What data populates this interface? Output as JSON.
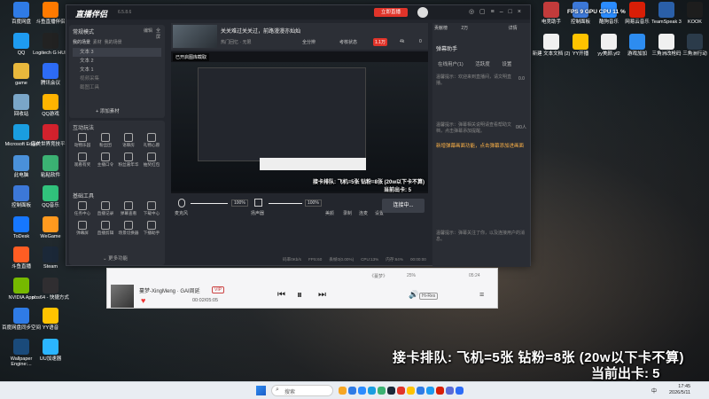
{
  "desktop_left_icons": [
    {
      "label": "百度网盘",
      "icon": "baidu-netdisk-icon",
      "color": "#2f7be5"
    },
    {
      "label": "斗鱼直播伴侣",
      "icon": "douyu-icon",
      "color": "#ff7a00"
    },
    {
      "label": "QQ",
      "icon": "qq-icon",
      "color": "#1e9bf0"
    },
    {
      "label": "Logitech G HUB",
      "icon": "logitech-icon",
      "color": "#222"
    },
    {
      "label": "game",
      "icon": "folder-icon",
      "color": "#e8b83c"
    },
    {
      "label": "腾讯会议",
      "icon": "tencent-meeting-icon",
      "color": "#2d6cf6"
    },
    {
      "label": "回收站",
      "icon": "recycle-bin-icon",
      "color": "#7aa6c8"
    },
    {
      "label": "QQ游戏",
      "icon": "qqgame-icon",
      "color": "#ffb400"
    },
    {
      "label": "Microsoft Edge",
      "icon": "edge-icon",
      "color": "#1a9de0"
    },
    {
      "label": "完美世界竞技平台",
      "icon": "perfect-world-icon",
      "color": "#d2222d"
    },
    {
      "label": "此电脑",
      "icon": "this-pc-icon",
      "color": "#4a90d9"
    },
    {
      "label": "粘粘软件",
      "icon": "app-icon",
      "color": "#3bb273"
    },
    {
      "label": "控制面板",
      "icon": "control-panel-icon",
      "color": "#3c78d8"
    },
    {
      "label": "QQ音乐",
      "icon": "qqmusic-icon",
      "color": "#31c27c"
    },
    {
      "label": "ToDesk",
      "icon": "todesk-icon",
      "color": "#1677ff"
    },
    {
      "label": "WeGame",
      "icon": "wegame-icon",
      "color": "#ff9a1f"
    },
    {
      "label": "斗鱼直播",
      "icon": "douyu-live-icon",
      "color": "#ff5d23"
    },
    {
      "label": "Steam",
      "icon": "steam-icon",
      "color": "#1b2838"
    },
    {
      "label": "NVIDIA App",
      "icon": "nvidia-icon",
      "color": "#76b900"
    },
    {
      "label": "obs64 - 快捷方式",
      "icon": "obs-icon",
      "color": "#302e31"
    },
    {
      "label": "百度网盘同步空间",
      "icon": "baidu-sync-icon",
      "color": "#2f7be5"
    },
    {
      "label": "YY语音",
      "icon": "yy-icon",
      "color": "#ffc300"
    },
    {
      "label": "Wallpaper Engine:...",
      "icon": "wallpaper-engine-icon",
      "color": "#1a4a7a"
    },
    {
      "label": "UU加速器",
      "icon": "uu-icon",
      "color": "#2bb5ff"
    }
  ],
  "desktop_top_icons": [
    {
      "label": "电竞助手",
      "icon": "esports-icon",
      "color": "#c23b3b"
    },
    {
      "label": "控制面板",
      "icon": "control-panel-icon",
      "color": "#3c78d8"
    },
    {
      "label": "酷狗音乐",
      "icon": "kugou-icon",
      "color": "#2b8cff"
    },
    {
      "label": "网易云音乐",
      "icon": "netease-music-icon",
      "color": "#d81e06"
    },
    {
      "label": "TeamSpeak 3",
      "icon": "teamspeak-icon",
      "color": "#2a5fa8"
    },
    {
      "label": "KOOK",
      "icon": "kook-icon",
      "color": "#1d1d1d"
    }
  ],
  "desktop_mid_icons": [
    {
      "label": "新建 文本文档 (2)",
      "icon": "text-file-icon",
      "color": "#f0f0f0"
    },
    {
      "label": "YY开播",
      "icon": "yy-live-icon",
      "color": "#ffc300"
    },
    {
      "label": "yy美颜.yf2",
      "icon": "file-icon",
      "color": "#f0f0f0"
    },
    {
      "label": "游戏加加",
      "icon": "game-plus-icon",
      "color": "#2d8cf0"
    },
    {
      "label": "三角洲改枪码",
      "icon": "doc-icon",
      "color": "#f0f0f0"
    },
    {
      "label": "三角洲行动",
      "icon": "delta-force-icon",
      "color": "#2b3b4a"
    }
  ],
  "perf_overlay": "FPS  9 GPU  CPU  11 %",
  "app": {
    "logo": "直播伴侣",
    "version": "6.5.8.6",
    "stream_title": "关关难过关关过，前路漫漫亦灿灿",
    "start_stream_label": "立即直播",
    "live_assistant_label": "开播提醒",
    "share_label": "分享",
    "username_tag": "热门回忆 · 无限",
    "volume_tag": "全分辨",
    "exam_label": "考核状态",
    "score_badge": "1.1万",
    "likes": "4k",
    "fans": "0",
    "header_labels": [
      "常规模式",
      "编辑",
      "全屏"
    ],
    "scene_tabs": [
      "我的场景",
      "素材",
      "我的场景"
    ],
    "scene_items": [
      "文本 3",
      "文本 2",
      "文本 1",
      "视频采集",
      "截图工具"
    ],
    "add_material_label": "添加素材",
    "interactive_title": "互动玩法",
    "interactive_tools": [
      "动物乐园",
      "粉丝团",
      "语聊房",
      "礼物心愿",
      "观看有奖",
      "主播口令",
      "粉丝嘉年华",
      "抽奖红包"
    ],
    "basic_tools_title": "基础工具",
    "basic_tools": [
      "任务中心",
      "直播记录",
      "弹幕查看",
      "下载中心",
      "弹幕屏",
      "直播剪辑",
      "场景切换器",
      "下播助手"
    ],
    "more_label": "更多功能",
    "preview_badge": "已开启图库截取",
    "audio": {
      "mic_label": "麦克风",
      "mic_value": "100%",
      "speaker_label": "扬声器",
      "speaker_value": "100%",
      "beauty_label": "美颜",
      "record_label": "录制",
      "pk_label": "连麦",
      "settings_label": "设置",
      "go_live_label": "连接中..."
    },
    "status_bar": [
      "码率0Kb/s",
      "FPS:60",
      "丢帧0(0.00%)",
      "CPU:13%",
      "内存:64%",
      "00:00:00"
    ],
    "right_panel": {
      "title": "弹幕助手",
      "tabs": [
        "在线用户(1)",
        "活跃度",
        "设置"
      ],
      "notice_1": "温馨提示：欢迎来到直播间，请文明直播。",
      "notice_2": "温馨提示：弹幕相关说明请查看帮助文档，点击弹幕添加提醒。",
      "highlight": "新增弹幕画面功能，点击弹幕添加进画面",
      "notice_3": "温馨提示：弹幕关注了你，以及连接用户的消息。",
      "counts": [
        "0.0",
        "0/0人"
      ],
      "top_tabs": [
        "贡献榜",
        "2万",
        "详情"
      ]
    }
  },
  "overlay": {
    "line_1": "接卡排队: 飞机=5张 钻粉=8张 (20w以下卡不算)",
    "line_2": "当前出卡: 5"
  },
  "preview_overlay": {
    "line_1": "接卡排队: 飞机=5张 钻粉=8张 (20w以下卡不算)",
    "line_2": "当前出卡: 5"
  },
  "music": {
    "song": "蔓梦-XingMeng · GAI周延",
    "badge": "VIP",
    "time": "00:02/05:05",
    "lyric": "《蔓梦》",
    "quality": "Hi-Res",
    "volume": "25%",
    "duration_right": "05:24"
  },
  "taskbar": {
    "search_placeholder": "搜索",
    "time": "17:45",
    "date": "2026/5/11",
    "lang": "中"
  },
  "colors": {
    "accent_red": "#e0342a",
    "panel": "#23262d"
  }
}
